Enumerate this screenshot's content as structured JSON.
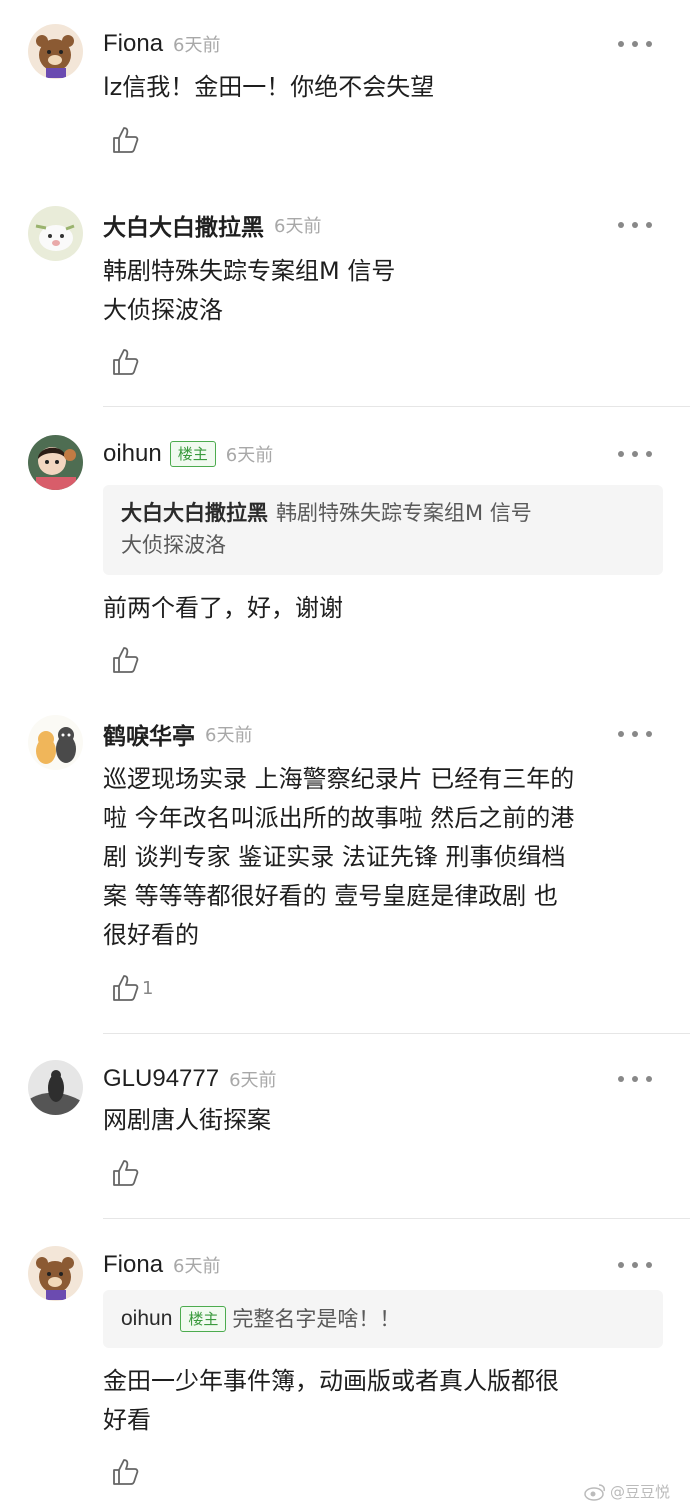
{
  "comments": [
    {
      "user": "Fiona",
      "time": "6天前",
      "body": "lz信我！金田一！你绝不会失望",
      "likes": ""
    },
    {
      "user": "大白大白撒拉黑",
      "time": "6天前",
      "body": "韩剧特殊失踪专案组M  信号\n 大侦探波洛",
      "likes": ""
    },
    {
      "user": "oihun",
      "badge": "楼主",
      "time": "6天前",
      "quote": {
        "user": "大白大白撒拉黑",
        "text": "韩剧特殊失踪专案组M  信号\n 大侦探波洛"
      },
      "body": "前两个看了，好，谢谢",
      "likes": ""
    },
    {
      "user": "鹤唳华亭",
      "time": "6天前",
      "body": "巡逻现场实录 上海警察纪录片 已经有三年的\n啦 今年改名叫派出所的故事啦 然后之前的港\n剧 谈判专家 鉴证实录 法证先锋 刑事侦缉档\n案 等等等都很好看的 壹号皇庭是律政剧 也\n很好看的",
      "likes": "1"
    },
    {
      "user": "GLU94777",
      "time": "6天前",
      "body": "网剧唐人街探案",
      "likes": ""
    },
    {
      "user": "Fiona",
      "time": "6天前",
      "quote": {
        "user": "oihun",
        "badge": "楼主",
        "text": "完整名字是啥！！"
      },
      "body": "金田一少年事件簿，动画版或者真人版都很\n好看",
      "likes": ""
    }
  ],
  "watermark": "@豆豆悦",
  "icons": {
    "like": "thumbs-up-icon",
    "more": "more-dots-icon",
    "watermark": "weibo-icon"
  },
  "colors": {
    "badge": "#4cab4e",
    "time": "#a8a8a8",
    "quote_bg": "#f5f5f5"
  }
}
